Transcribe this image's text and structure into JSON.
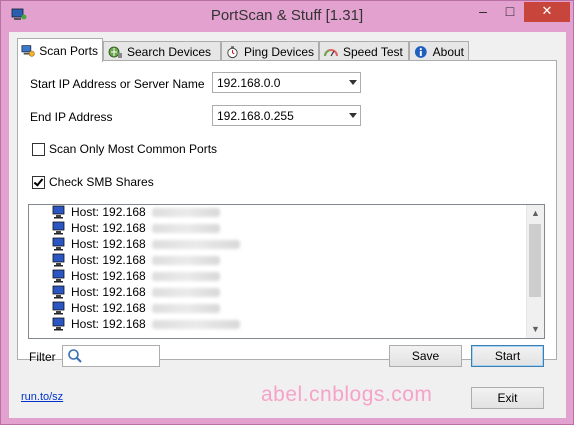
{
  "window": {
    "title": "PortScan & Stuff [1.31]",
    "minimize": "–",
    "maximize": "□",
    "close": "✕"
  },
  "tabs": [
    {
      "label": "Scan Ports",
      "icon": "network-scan-icon"
    },
    {
      "label": "Search Devices",
      "icon": "search-devices-icon"
    },
    {
      "label": "Ping Devices",
      "icon": "stopwatch-icon"
    },
    {
      "label": "Speed Test",
      "icon": "speedometer-icon"
    },
    {
      "label": "About",
      "icon": "info-icon"
    }
  ],
  "form": {
    "start_label": "Start IP Address or Server Name",
    "start_value": "192.168.0.0",
    "end_label": "End IP Address",
    "end_value": "192.168.0.255",
    "common_ports_label": "Scan Only Most Common Ports",
    "common_ports_checked": false,
    "smb_label": "Check SMB Shares",
    "smb_checked": true
  },
  "hosts": [
    "Host: 192.168",
    "Host: 192.168",
    "Host: 192.168",
    "Host: 192.168",
    "Host: 192.168",
    "Host: 192.168",
    "Host: 192.168",
    "Host: 192.168"
  ],
  "filter": {
    "label": "Filter",
    "value": ""
  },
  "buttons": {
    "save": "Save",
    "start": "Start",
    "exit": "Exit"
  },
  "footer": {
    "link": "run.to/sz",
    "watermark": "abel.cnblogs.com"
  },
  "colors": {
    "frame": "#e3a1cf",
    "close": "#c7453a",
    "link": "#0033cc"
  }
}
